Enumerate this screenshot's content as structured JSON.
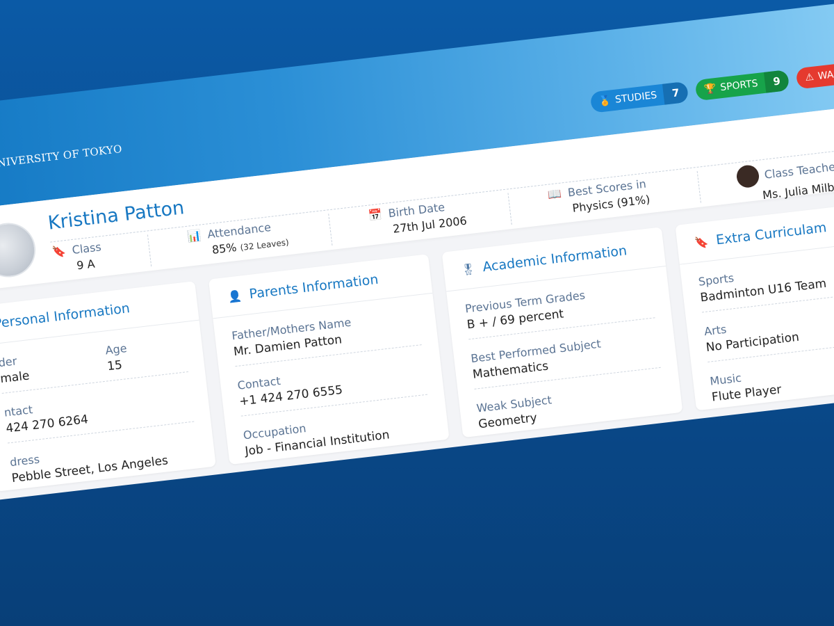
{
  "brand": {
    "university": "UNIVERSITY OF TOKYO"
  },
  "badges": [
    {
      "label": "STUDIES",
      "count": "7",
      "icon": "medal-icon",
      "color": "#1a86d6"
    },
    {
      "label": "SPORTS",
      "count": "9",
      "icon": "trophy-icon",
      "color": "#17a34a"
    },
    {
      "label": "WARNINGS",
      "icon": "warning-icon",
      "color": "#e53a2f"
    }
  ],
  "student": {
    "name": "Kristina Patton",
    "class_label": "Class",
    "class_value": "9 A",
    "attendance_label": "Attendance",
    "attendance_value": "85%",
    "attendance_note": "(32 Leaves)",
    "birth_label": "Birth Date",
    "birth_value": "27th Jul 2006",
    "best_label": "Best Scores in",
    "best_value": "Physics (91%)",
    "teacher_label": "Class Teacher",
    "teacher_value": "Ms. Julia Milb"
  },
  "personal": {
    "title": "Personal Information",
    "gender_label": "der",
    "gender_value": "male",
    "age_label": "Age",
    "age_value": "15",
    "contact_label": "ntact",
    "contact_value": "424 270 6264",
    "address_label": "dress",
    "address_value": "Pebble Street, Los Angeles"
  },
  "parents": {
    "title": "Parents Information",
    "name_label": "Father/Mothers Name",
    "name_value": "Mr. Damien Patton",
    "contact_label": "Contact",
    "contact_value": "+1 424 270 6555",
    "occupation_label": "Occupation",
    "occupation_value": "Job - Financial Institution"
  },
  "academic": {
    "title": "Academic Information",
    "grades_label": "Previous Term Grades",
    "grades_value": "B + / 69 percent",
    "best_label": "Best Performed Subject",
    "best_value": "Mathematics",
    "weak_label": "Weak Subject",
    "weak_value": "Geometry"
  },
  "extra": {
    "title": "Extra Curriculam",
    "sports_label": "Sports",
    "sports_value": "Badminton U16 Team",
    "arts_label": "Arts",
    "arts_value": "No Participation",
    "music_label": "Music",
    "music_value": "Flute Player"
  }
}
